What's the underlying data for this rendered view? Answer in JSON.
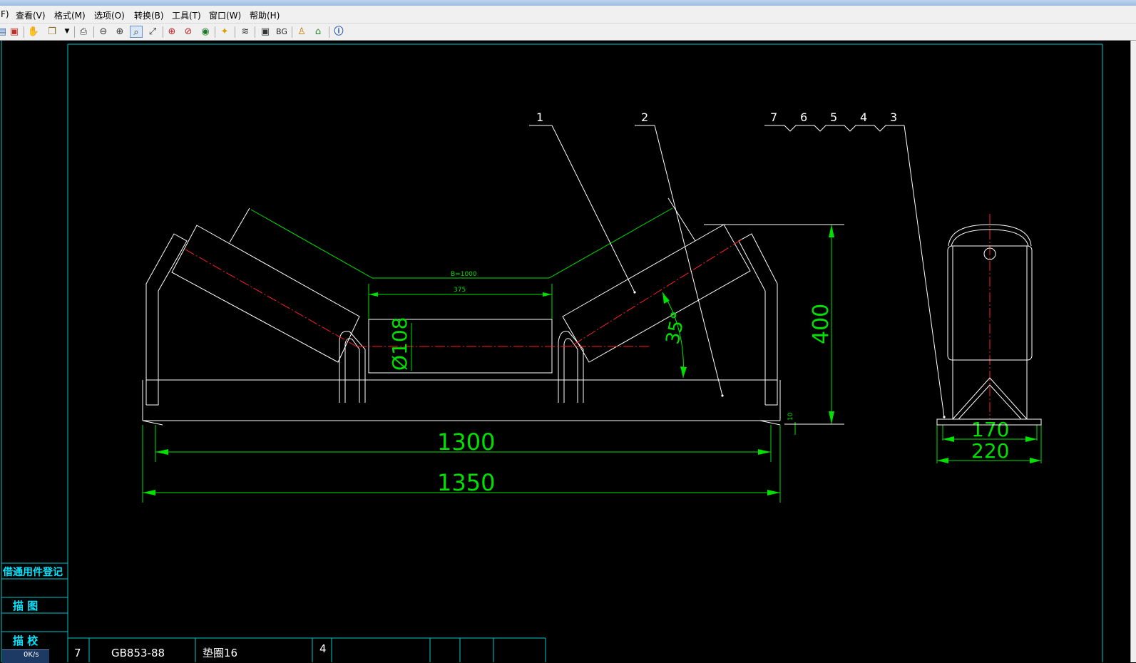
{
  "menu": [
    {
      "label": "F)"
    },
    {
      "label": "查看(V)"
    },
    {
      "label": "格式(M)"
    },
    {
      "label": "选项(O)"
    },
    {
      "label": "转换(B)"
    },
    {
      "label": "工具(T)"
    },
    {
      "label": "窗口(W)"
    },
    {
      "label": "帮助(H)"
    }
  ],
  "toolbar": {
    "icons": [
      "open-icon",
      "save-icon",
      "pan-icon",
      "copy-icon",
      "dropdown-icon",
      "print-icon",
      "zoom-out-icon",
      "zoom-in-icon",
      "zoom-window-icon",
      "zoom-extents-icon",
      "zoom-realtime-icon",
      "zoom-previous-icon",
      "view-icon",
      "layer-icon",
      "layers-icon",
      "fit-icon",
      "home-icon",
      "info-icon"
    ],
    "bg_label": "BG"
  },
  "drawing": {
    "callouts_left": [
      "1",
      "2"
    ],
    "callouts_right": [
      "7",
      "6",
      "5",
      "4",
      "3"
    ],
    "dim_belt": "B=1000",
    "dim_375": "375",
    "dim_diameter": "Ø108",
    "dim_angle": "35°",
    "dim_400": "400",
    "dim_10": "10",
    "dim_1300": "1300",
    "dim_1350": "1350",
    "dim_170": "170",
    "dim_220": "220"
  },
  "title_block": {
    "reg": "借通用件登记",
    "trace": "描 图",
    "check": "描 校",
    "row_no": "7",
    "row_code": "GB853-88",
    "row_name": "垫圈16",
    "row_qty": "4"
  },
  "status": {
    "speed": "0K/s"
  },
  "colors": {
    "background": "#000000",
    "frame": "#00c8c8",
    "geometry": "#ffffff",
    "dimension": "#00ff00",
    "centerline": "#ff0000"
  }
}
